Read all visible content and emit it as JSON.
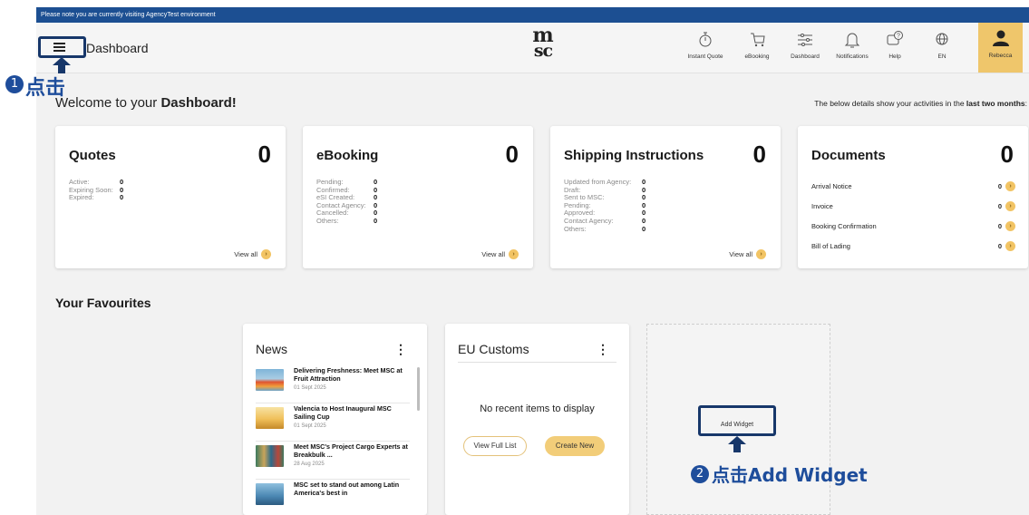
{
  "env_notice": "Please note you are currently visiting AgencyTest environment",
  "header": {
    "page_title": "Dashboard",
    "logo_line1": "m",
    "logo_line2": "sc",
    "nav": [
      {
        "label": "Instant Quote",
        "icon": "stopwatch-icon"
      },
      {
        "label": "eBooking",
        "icon": "cart-icon"
      },
      {
        "label": "Dashboard",
        "icon": "sliders-icon"
      },
      {
        "label": "Notifications",
        "icon": "bell-icon"
      },
      {
        "label": "Help",
        "icon": "help-chat-icon"
      },
      {
        "label": "EN",
        "icon": "globe-icon"
      }
    ],
    "user_name": "Rebecca"
  },
  "welcome": {
    "prefix": "Welcome to your ",
    "bold": "Dashboard!"
  },
  "activity_note": {
    "prefix": "The below details show your activities in the ",
    "bold": "last two months",
    "suffix": ":"
  },
  "cards": {
    "quotes": {
      "title": "Quotes",
      "count": "0",
      "view_all": "View all",
      "stats": [
        {
          "label": "Active:",
          "value": "0"
        },
        {
          "label": "Expiring Soon:",
          "value": "0"
        },
        {
          "label": "Expired:",
          "value": "0"
        }
      ]
    },
    "ebooking": {
      "title": "eBooking",
      "count": "0",
      "view_all": "View all",
      "stats": [
        {
          "label": "Pending:",
          "value": "0"
        },
        {
          "label": "Confirmed:",
          "value": "0"
        },
        {
          "label": "eSI Created:",
          "value": "0"
        },
        {
          "label": "Contact Agency:",
          "value": "0"
        },
        {
          "label": "Cancelled:",
          "value": "0"
        },
        {
          "label": "Others:",
          "value": "0"
        }
      ]
    },
    "shipping": {
      "title": "Shipping Instructions",
      "count": "0",
      "view_all": "View all",
      "stats": [
        {
          "label": "Updated from Agency:",
          "value": "0"
        },
        {
          "label": "Draft:",
          "value": "0"
        },
        {
          "label": "Sent to MSC:",
          "value": "0"
        },
        {
          "label": "Pending:",
          "value": "0"
        },
        {
          "label": "Approved:",
          "value": "0"
        },
        {
          "label": "Contact Agency:",
          "value": "0"
        },
        {
          "label": "Others:",
          "value": "0"
        }
      ]
    },
    "documents": {
      "title": "Documents",
      "count": "0",
      "rows": [
        {
          "label": "Arrival Notice",
          "value": "0"
        },
        {
          "label": "Invoice",
          "value": "0"
        },
        {
          "label": "Booking Confirmation",
          "value": "0"
        },
        {
          "label": "Bill of Lading",
          "value": "0"
        }
      ]
    }
  },
  "favourites": {
    "title": "Your Favourites",
    "news": {
      "title": "News",
      "items": [
        {
          "headline": "Delivering Freshness: Meet MSC at Fruit Attraction",
          "date": "01 Sept 2025"
        },
        {
          "headline": "Valencia to Host Inaugural MSC Sailing Cup",
          "date": "01 Sept 2025"
        },
        {
          "headline": "Meet MSC's Project Cargo Experts at Breakbulk ...",
          "date": "28 Aug 2025"
        },
        {
          "headline": "MSC set to stand out among Latin America's best in",
          "date": ""
        }
      ]
    },
    "eu_customs": {
      "title": "EU Customs",
      "empty_message": "No recent items to display",
      "view_full_list": "View Full List",
      "create_new": "Create New"
    },
    "add_widget": "Add Widget"
  },
  "annotations": {
    "step1": {
      "number": "1",
      "label": "点击"
    },
    "step2": {
      "number": "2",
      "label": "点击Add Widget"
    }
  },
  "colors": {
    "env_bar": "#1c4f92",
    "accent": "#f2c464",
    "annotation": "#1e4d9b"
  }
}
